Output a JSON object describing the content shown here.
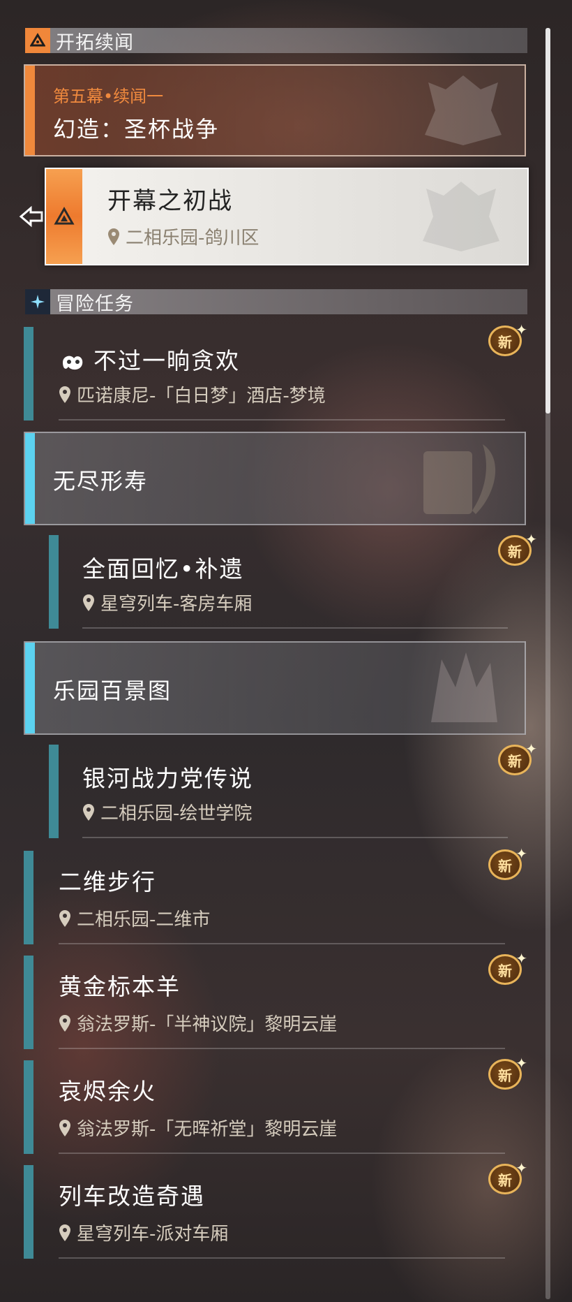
{
  "story_section": {
    "title": "开拓续闻",
    "chapter": {
      "subtitle": "第五幕•续闻一",
      "title": "幻造：圣杯战争"
    },
    "selected_quest": {
      "title": "开幕之初战",
      "location": "二相乐园-鸽川区"
    }
  },
  "adventure_section": {
    "title": "冒险任务",
    "new_badge": "新",
    "items": [
      {
        "title": "不过一晌贪欢",
        "location": "匹诺康尼-「白日梦」酒店-梦境"
      },
      {
        "group": "无尽形寿"
      },
      {
        "title": "全面回忆•补遗",
        "location": "星穹列车-客房车厢"
      },
      {
        "group": "乐园百景图"
      },
      {
        "title": "银河战力党传说",
        "location": "二相乐园-绘世学院"
      },
      {
        "title": "二维步行",
        "location": "二相乐园-二维市"
      },
      {
        "title": "黄金标本羊",
        "location": "翁法罗斯-「半神议院」黎明云崖"
      },
      {
        "title": "哀烬余火",
        "location": "翁法罗斯-「无晖祈堂」黎明云崖"
      },
      {
        "title": "列车改造奇遇",
        "location": "星穹列车-派对车厢"
      }
    ]
  },
  "colors": {
    "story_accent": "#f0893c",
    "adventure_accent": "#3f8a96",
    "group_accent": "#5cd2f0"
  }
}
